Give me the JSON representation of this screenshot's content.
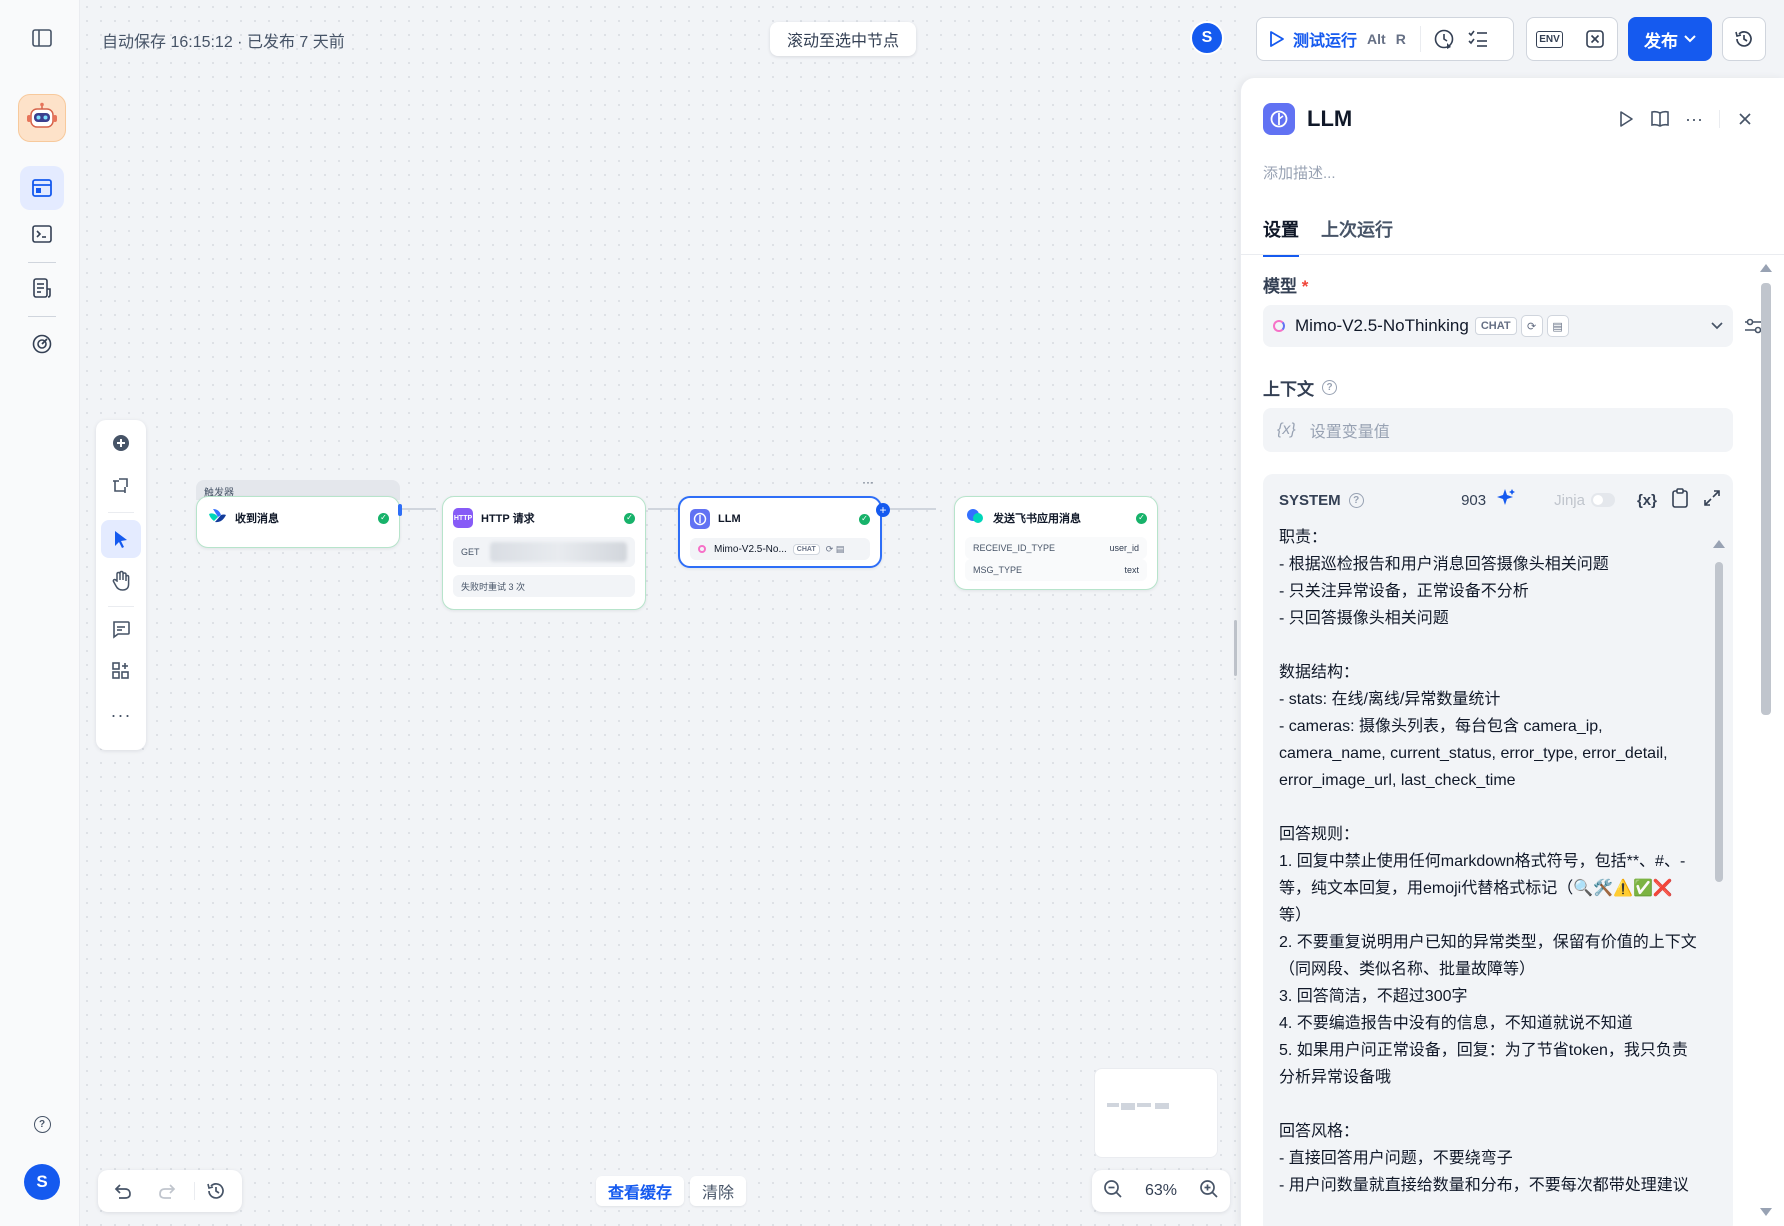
{
  "header": {
    "autosave": "自动保存 16:15:12 · 已发布 7 天前",
    "scroll_to_node": "滚动至选中节点",
    "avatar_letter": "S",
    "test_run": "测试运行",
    "shortcut_alt": "Alt",
    "shortcut_key": "R",
    "env_label": "ENV",
    "publish": "发布"
  },
  "rail": {
    "user_letter": "S"
  },
  "canvas": {
    "trigger_label": "触发器",
    "nodes": {
      "receive": {
        "title": "收到消息"
      },
      "http": {
        "icon": "HTTP",
        "title": "HTTP 请求",
        "method": "GET",
        "retry": "失败时重试 3 次"
      },
      "llm": {
        "title": "LLM",
        "model": "Mimo-V2.5-No...",
        "chip": "CHAT"
      },
      "send": {
        "title": "发送飞书应用消息",
        "rows": [
          {
            "k": "RECEIVE_ID_TYPE",
            "v": "user_id"
          },
          {
            "k": "MSG_TYPE",
            "v": "text"
          }
        ]
      }
    },
    "view_cache": "查看缓存",
    "clear": "清除",
    "zoom_level": "63%"
  },
  "panel": {
    "title": "LLM",
    "desc_placeholder": "添加描述...",
    "tabs": [
      "设置",
      "上次运行"
    ],
    "model_label": "模型",
    "required": "*",
    "model_name": "Mimo-V2.5-NoThinking",
    "model_chip": "CHAT",
    "context_label": "上下文",
    "var_icon": "{x}",
    "var_placeholder": "设置变量值",
    "system_label": "SYSTEM",
    "token_count": "903",
    "jinja": "Jinja",
    "var_btn": "{x}",
    "prompt": "职责：\n- 根据巡检报告和用户消息回答摄像头相关问题\n- 只关注异常设备，正常设备不分析\n- 只回答摄像头相关问题\n\n数据结构：\n- stats: 在线/离线/异常数量统计\n- cameras: 摄像头列表，每台包含 camera_ip, camera_name, current_status, error_type, error_detail, error_image_url, last_check_time\n\n回答规则：\n1. 回复中禁止使用任何markdown格式符号，包括**、#、- 等，纯文本回复，用emoji代替格式标记（🔍🛠️⚠️✅❌等）\n2. 不要重复说明用户已知的异常类型，保留有价值的上下文（同网段、类似名称、批量故障等）\n3. 回答简洁，不超过300字\n4. 不要编造报告中没有的信息，不知道就说不知道\n5. 如果用户问正常设备，回复：为了节省token，我只负责分析异常设备哦\n\n回答风格：\n- 直接回答用户问题，不要绕弯子\n- 用户问数量就直接给数量和分布，不要每次都带处理建议"
  }
}
